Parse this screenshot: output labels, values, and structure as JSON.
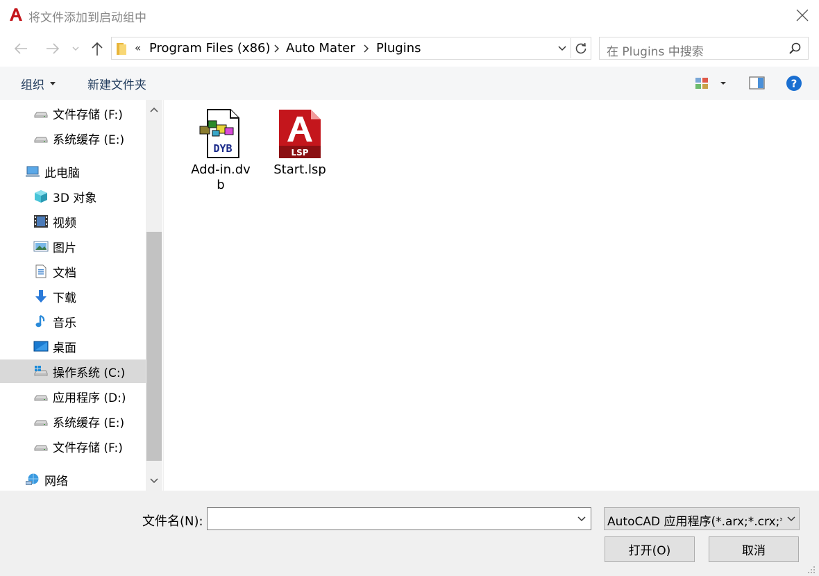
{
  "window": {
    "title": "将文件添加到启动组中",
    "app_icon": "autocad-icon"
  },
  "address": {
    "overflow": "«",
    "crumbs": [
      "Program Files (x86)",
      "Auto Mater",
      "Plugins"
    ]
  },
  "search": {
    "placeholder": "在 Plugins 中搜索"
  },
  "toolbar": {
    "organize_label": "组织",
    "new_folder_label": "新建文件夹"
  },
  "nav": {
    "items": [
      {
        "label": "文件存储 (F:)",
        "icon": "drive-icon"
      },
      {
        "label": "系统缓存 (E:)",
        "icon": "drive-icon"
      },
      {
        "label": "此电脑",
        "icon": "computer-icon"
      },
      {
        "label": "3D 对象",
        "icon": "3d-objects-icon"
      },
      {
        "label": "视频",
        "icon": "video-icon"
      },
      {
        "label": "图片",
        "icon": "pictures-icon"
      },
      {
        "label": "文档",
        "icon": "documents-icon"
      },
      {
        "label": "下载",
        "icon": "download-icon"
      },
      {
        "label": "音乐",
        "icon": "music-icon"
      },
      {
        "label": "桌面",
        "icon": "desktop-icon"
      },
      {
        "label": "操作系统 (C:)",
        "icon": "windows-drive-icon",
        "selected": true
      },
      {
        "label": "应用程序 (D:)",
        "icon": "drive-icon"
      },
      {
        "label": "系统缓存 (E:)",
        "icon": "drive-icon"
      },
      {
        "label": "文件存储 (F:)",
        "icon": "drive-icon"
      },
      {
        "label": "网络",
        "icon": "network-icon"
      }
    ]
  },
  "files": [
    {
      "name": "Add-in.dvb",
      "icon": "dvb-file-icon",
      "badge": "DYB"
    },
    {
      "name": "Start.lsp",
      "icon": "lsp-file-icon",
      "badge": "LSP"
    }
  ],
  "bottom": {
    "filename_label": "文件名(N):",
    "filename_value": "",
    "filetype_value": "AutoCAD 应用程序(*.arx;*.crx;*.lsp;*.dvb;*.dbx;*.vlx;*.fas)",
    "open_label": "打开(O)",
    "cancel_label": "取消"
  },
  "colors": {
    "autocad_red": "#c4161c",
    "help_blue": "#1a6fd1",
    "selection": "#d9d9d9"
  }
}
